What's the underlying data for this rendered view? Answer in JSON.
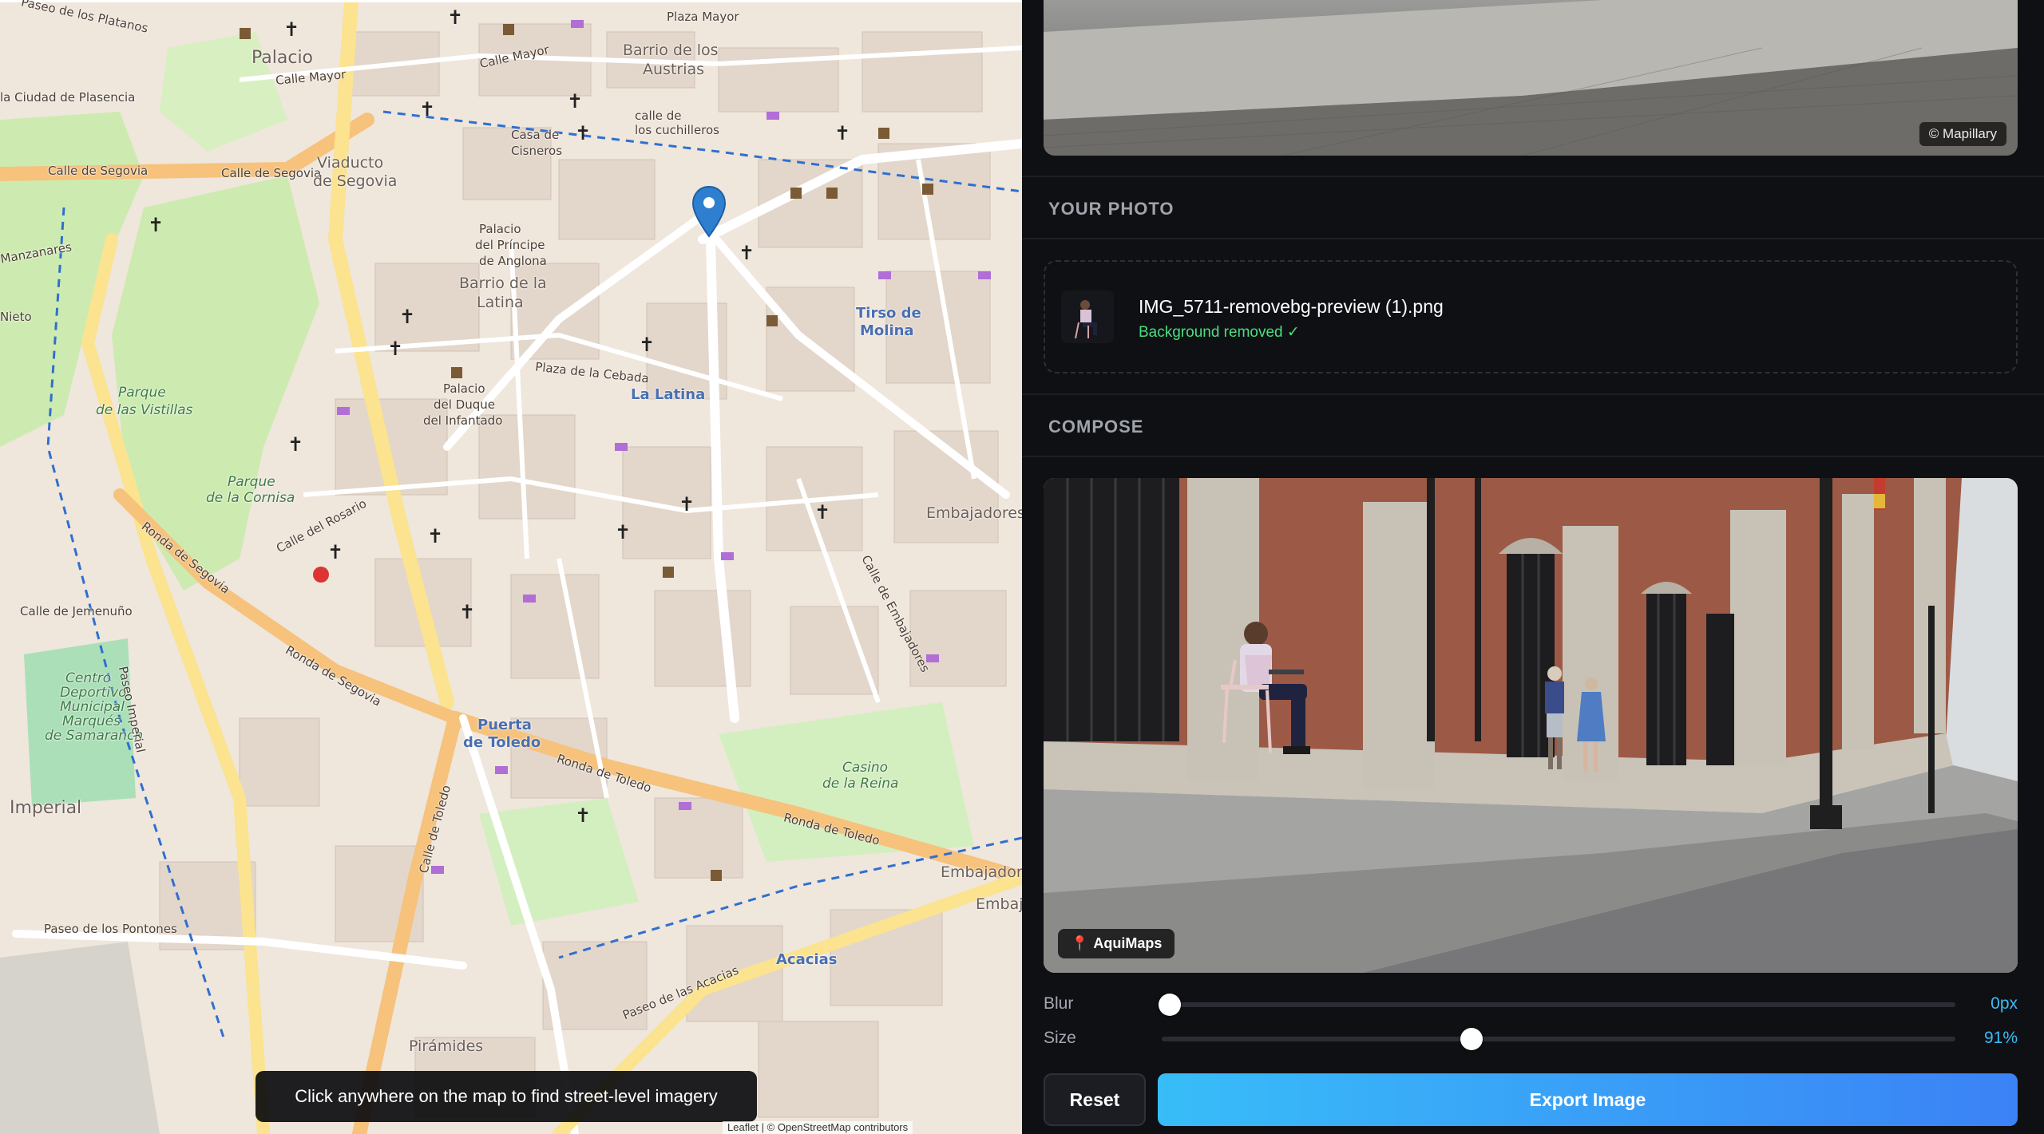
{
  "map": {
    "hint": "Click anywhere on the map to find street-level imagery",
    "attribution": "Leaflet | © OpenStreetMap contributors",
    "labels": {
      "palacio": "Palacio",
      "calle_mayor_1": "Calle Mayor",
      "calle_mayor_2": "Calle Mayor",
      "barrio_austrias_1": "Barrio de los",
      "barrio_austrias_2": "Austrias",
      "plaza_mayor": "Plaza Mayor",
      "ciudad_plasencia": "la Ciudad de Plasencia",
      "calle_segovia": "Calle de Segovia",
      "calle_segovia_2": "Calle de Segovia",
      "viaducto_1": "Viaducto",
      "viaducto_2": "de Segovia",
      "casa_cisneros_1": "Casa de",
      "casa_cisneros_2": "Cisneros",
      "cuchilleros_1": "calle de",
      "cuchilleros_2": "los cuchilleros",
      "manzanares": "Manzanares",
      "palacio_principe_1": "Palacio",
      "palacio_principe_2": "del Príncipe",
      "palacio_principe_3": "de Anglona",
      "barrio_latina_1": "Barrio de la",
      "barrio_latina_2": "Latina",
      "tirso_1": "Tirso de",
      "tirso_2": "Molina",
      "plaza_cebada": "Plaza de la Cebada",
      "la_latina": "La Latina",
      "palacio_duque_1": "Palacio",
      "palacio_duque_2": "del Duque",
      "palacio_duque_3": "del Infantado",
      "parque_vistillas_1": "Parque",
      "parque_vistillas_2": "de las Vistillas",
      "parque_cornisa_1": "Parque",
      "parque_cornisa_2": "de la Cornisa",
      "calle_rosario": "Calle del Rosario",
      "embajadores_1": "Embajadores",
      "embajadores_2": "Embajadore",
      "embajadores_3": "Embaj",
      "calle_jemenuno": "Calle de Jemenuño",
      "ronda_segovia_1": "Ronda de Segovia",
      "ronda_segovia_2": "Ronda de Segovia",
      "centro_deportivo_1": "Centro",
      "centro_deportivo_2": "Deportivo",
      "centro_deportivo_3": "Municipal",
      "centro_deportivo_4": "Marqués",
      "centro_deportivo_5": "de Samaranch",
      "puerta_toledo_1": "Puerta",
      "puerta_toledo_2": "de Toledo",
      "ronda_toledo_1": "Ronda de Toledo",
      "ronda_toledo_2": "Ronda de Toledo",
      "casino_1": "Casino",
      "casino_2": "de la Reina",
      "imperial": "Imperial",
      "acacias": "Acacias",
      "paseo_acacias": "Paseo de las Acacias",
      "piramides": "Pirámides",
      "paseo_imperial": "Paseo Imperial",
      "calle_toledo": "Calle de Toledo",
      "calle_embajadores": "Calle de Embajadores",
      "nieto": "Nieto",
      "paseo_pontones": "Paseo de los Pontones",
      "paseo_plantos": "Paseo de los Platanos"
    }
  },
  "panel": {
    "preview_credit": "© Mapillary",
    "your_photo_title": "YOUR PHOTO",
    "photo": {
      "filename": "IMG_5711-removebg-preview (1).png",
      "status": "Background removed ✓"
    },
    "compose_title": "COMPOSE",
    "compose_badge": "AquiMaps",
    "blur": {
      "label": "Blur",
      "value": "0px",
      "fraction": 0.0
    },
    "size": {
      "label": "Size",
      "value": "91%",
      "fraction": 0.39
    },
    "reset_label": "Reset",
    "export_label": "Export Image"
  },
  "colors": {
    "accent": "#38bdf8",
    "accent_2": "#3b82f6",
    "success": "#4ade80",
    "panel_bg": "#0f1014"
  }
}
